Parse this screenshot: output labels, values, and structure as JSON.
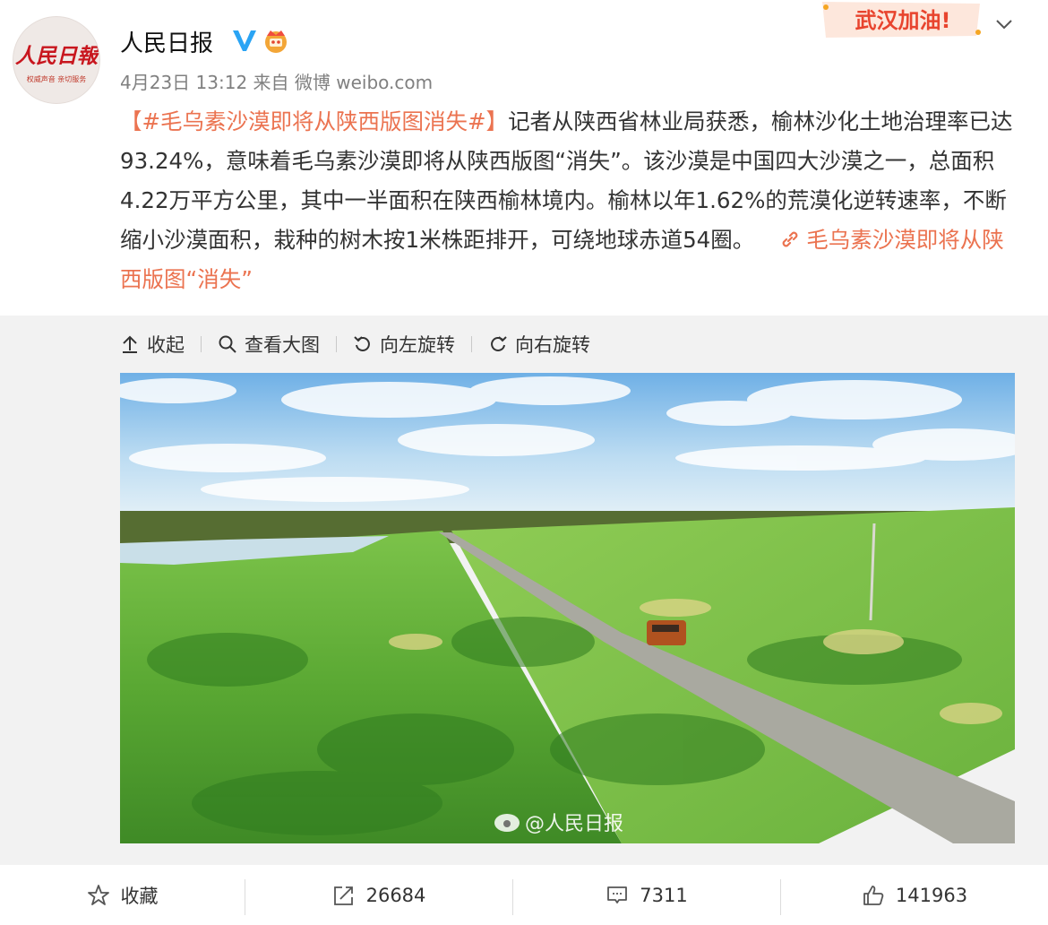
{
  "account": {
    "name": "人民日报",
    "logo_text": "人民日報",
    "logo_subtext": "权威声音 亲切服务",
    "timestamp": "4月23日 13:12",
    "source": "来自 微博 weibo.com",
    "badge": "武汉加油!"
  },
  "post": {
    "hashtag": "【#毛乌素沙漠即将从陕西版图消失#】",
    "body": "记者从陕西省林业局获悉，榆林沙化土地治理率已达93.24%，意味着毛乌素沙漠即将从陕西版图“消失”。该沙漠是中国四大沙漠之一，总面积4.22万平方公里，其中一半面积在陕西榆林境内。榆林以年1.62%的荒漠化逆转速率，不断缩小沙漠面积，栽种的树木按1米株距排开，可绕地球赤道54圈。",
    "link_text": "毛乌素沙漠即将从陕西版图“消失”"
  },
  "media_toolbar": {
    "collapse": "收起",
    "view_large": "查看大图",
    "rotate_left": "向左旋转",
    "rotate_right": "向右旋转"
  },
  "image": {
    "watermark": "@人民日报"
  },
  "footer": {
    "favorite": "收藏",
    "reposts": "26684",
    "comments": "7311",
    "likes": "141963"
  },
  "colors": {
    "accent": "#eb7350",
    "logo_red": "#c8161e",
    "verified": "#2aa4f4"
  }
}
